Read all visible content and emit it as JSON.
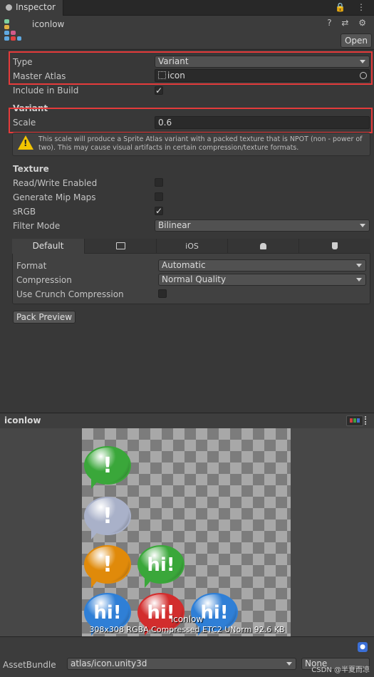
{
  "window": {
    "tab_label": "Inspector",
    "asset_title": "iconlow",
    "toolbar_icons": "🔒 ⋮",
    "header_icons": "? ⇄ ⚙",
    "open_button": "Open"
  },
  "fields": {
    "type": {
      "label": "Type",
      "value": "Variant"
    },
    "master_atlas": {
      "label": "Master Atlas",
      "value": "icon"
    },
    "include_in_build": {
      "label": "Include in Build",
      "checked": true
    },
    "variant_header": "Variant",
    "scale": {
      "label": "Scale",
      "value": "0.6"
    },
    "warning": "This scale will produce a Sprite Atlas variant with a packed texture that is NPOT (non - power of two). This may cause visual artifacts in certain compression/texture formats."
  },
  "texture": {
    "header": "Texture",
    "read_write": {
      "label": "Read/Write Enabled",
      "checked": false
    },
    "mip_maps": {
      "label": "Generate Mip Maps",
      "checked": false
    },
    "srgb": {
      "label": "sRGB",
      "checked": true
    },
    "filter_mode": {
      "label": "Filter Mode",
      "value": "Bilinear"
    }
  },
  "platform": {
    "tabs": [
      "Default",
      "desktop-icon",
      "iOS",
      "android-icon",
      "webgl-icon"
    ],
    "default_label": "Default",
    "ios_label": "iOS",
    "format": {
      "label": "Format",
      "value": "Automatic"
    },
    "compression": {
      "label": "Compression",
      "value": "Normal Quality"
    },
    "crunch": {
      "label": "Use Crunch Compression",
      "checked": false
    }
  },
  "pack_preview_button": "Pack Preview",
  "preview": {
    "title": "iconlow",
    "atlas_name": "iconlow",
    "info": "308x308 RGBA Compressed ETC2 UNorm   92.6 KB",
    "icons": [
      {
        "glyph": "!",
        "color": "#3aa73a"
      },
      {
        "glyph": "!",
        "color": "#a9b1c9"
      },
      {
        "glyph": "!",
        "color": "#e08a0a"
      },
      {
        "glyph": "hi!",
        "color": "#3aa73a"
      },
      {
        "glyph": "hi!",
        "color": "#2f7fd6"
      },
      {
        "glyph": "hi!",
        "color": "#d22d2d"
      },
      {
        "glyph": "hi!",
        "color": "#2f7fd6"
      }
    ]
  },
  "footer": {
    "asset_bundle_label": "AssetBundle",
    "asset_bundle_value": "atlas/icon.unity3d",
    "variant_value": "None",
    "watermark": "CSDN @半夏而凉"
  }
}
